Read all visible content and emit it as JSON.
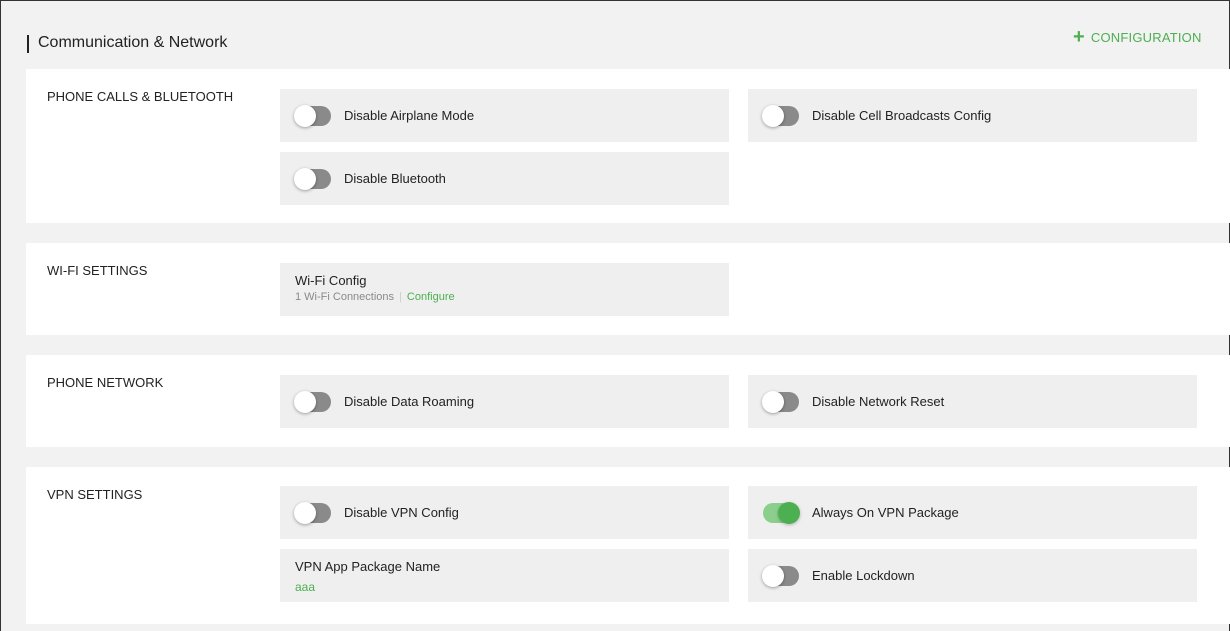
{
  "header": {
    "title": "Communication & Network",
    "config_button": "CONFIGURATION",
    "config_icon": "plus-icon"
  },
  "sections": [
    {
      "title": "PHONE CALLS & BLUETOOTH",
      "toggles": [
        {
          "label": "Disable Airplane Mode",
          "on": false
        },
        {
          "label": "Disable Cell Broadcasts Config",
          "on": false
        },
        {
          "label": "Disable Bluetooth",
          "on": false
        }
      ]
    },
    {
      "title": "WI-FI SETTINGS",
      "wifi": {
        "title": "Wi-Fi Config",
        "count": "1 Wi-Fi Connections",
        "separator": "|",
        "link": "Configure"
      }
    },
    {
      "title": "PHONE NETWORK",
      "toggles": [
        {
          "label": "Disable Data Roaming",
          "on": false
        },
        {
          "label": "Disable Network Reset",
          "on": false
        }
      ]
    },
    {
      "title": "VPN SETTINGS",
      "toggles": [
        {
          "label": "Disable VPN Config",
          "on": false
        },
        {
          "label": "Always On VPN Package",
          "on": true
        },
        {
          "label": "Enable Lockdown",
          "on": false
        }
      ],
      "package": {
        "title": "VPN App Package Name",
        "value": "aaa"
      }
    }
  ],
  "colors": {
    "accent": "#4caf50",
    "toggle_off": "#8a8a8a",
    "toggle_on_track": "#8ccf8c",
    "card_bg": "#efefef",
    "page_bg": "#f2f2f2"
  }
}
